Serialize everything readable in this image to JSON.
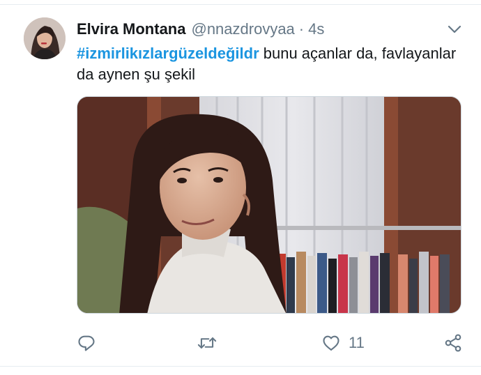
{
  "tweet": {
    "author_name": "Elvira Montana",
    "handle": "@nnazdrovyaa",
    "separator": "·",
    "time": "4s",
    "hashtag": "#izmirlikızlargüzeldeğildr",
    "text_rest": " bunu açanlar da, favlayanlar da aynen şu şekil"
  },
  "actions": {
    "reply_icon": "reply-icon",
    "retweet_icon": "retweet-icon",
    "like_icon": "heart-icon",
    "like_count": "11",
    "share_icon": "share-icon"
  },
  "colors": {
    "hashtag": "#1b95e0",
    "muted": "#657786",
    "text": "#14171a",
    "border": "#e6ecf0"
  }
}
